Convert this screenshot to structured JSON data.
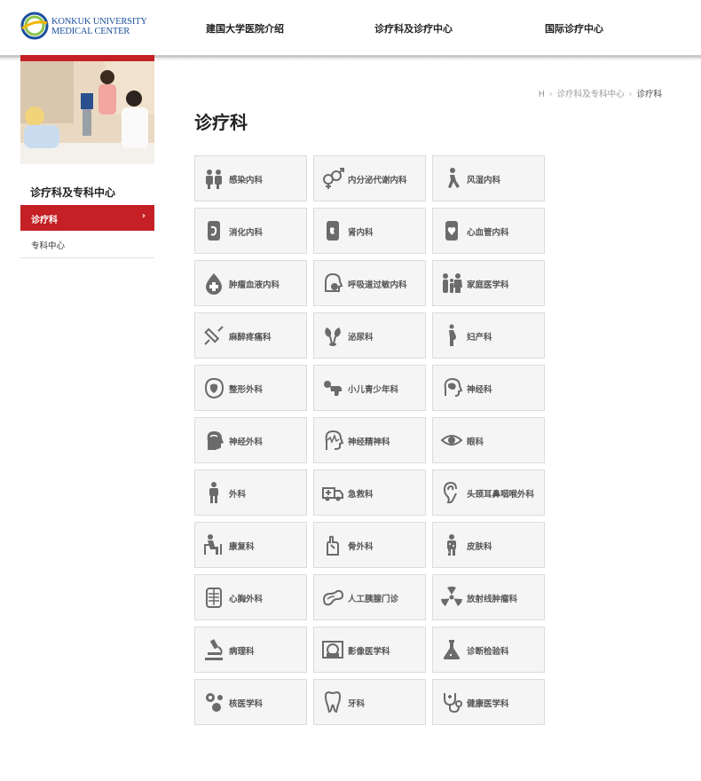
{
  "header": {
    "logo_line1": "KONKUK UNIVERSITY",
    "logo_line2": "MEDICAL CENTER",
    "nav": [
      "建国大学医院介绍",
      "诊疗科及诊疗中心",
      "国际诊疗中心"
    ]
  },
  "sidebar": {
    "title": "诊疗科及专科中心",
    "items": [
      {
        "label": "诊疗科",
        "active": true,
        "chevron": "›"
      },
      {
        "label": "专科中心",
        "active": false
      }
    ]
  },
  "breadcrumb": {
    "home": "H",
    "sep": "›",
    "items": [
      "诊疗科及专科中心",
      "诊疗科"
    ]
  },
  "main": {
    "title": "诊疗科",
    "departments": [
      {
        "label": "感染内科",
        "icon": "people-icon"
      },
      {
        "label": "内分泌代谢内科",
        "icon": "gender-icon"
      },
      {
        "label": "风湿内科",
        "icon": "walking-person-icon"
      },
      {
        "label": "消化内科",
        "icon": "stomach-icon"
      },
      {
        "label": "肾内科",
        "icon": "kidney-icon"
      },
      {
        "label": "心血管内科",
        "icon": "heart-icon"
      },
      {
        "label": "肿瘤血液内科",
        "icon": "blood-drop-icon"
      },
      {
        "label": "呼吸道过敏内科",
        "icon": "respiratory-icon"
      },
      {
        "label": "家庭医学科",
        "icon": "family-icon"
      },
      {
        "label": "麻醉疼痛科",
        "icon": "syringe-icon"
      },
      {
        "label": "泌尿科",
        "icon": "urinary-icon"
      },
      {
        "label": "妇产科",
        "icon": "pregnant-icon"
      },
      {
        "label": "整形外科",
        "icon": "face-icon"
      },
      {
        "label": "小儿青少年科",
        "icon": "baby-icon"
      },
      {
        "label": "神经科",
        "icon": "brain-profile-icon"
      },
      {
        "label": "神经外科",
        "icon": "head-icon"
      },
      {
        "label": "神经精神科",
        "icon": "mind-icon"
      },
      {
        "label": "眼科",
        "icon": "eye-icon"
      },
      {
        "label": "外科",
        "icon": "surgeon-icon"
      },
      {
        "label": "急救科",
        "icon": "ambulance-icon"
      },
      {
        "label": "头颈耳鼻咽喉外科",
        "icon": "ear-icon"
      },
      {
        "label": "康复科",
        "icon": "rehab-icon"
      },
      {
        "label": "骨外科",
        "icon": "bone-hand-icon"
      },
      {
        "label": "皮肤科",
        "icon": "skin-icon"
      },
      {
        "label": "心胸外科",
        "icon": "chest-icon"
      },
      {
        "label": "人工胰腺门诊",
        "icon": "pancreas-icon"
      },
      {
        "label": "放射线肿瘤科",
        "icon": "radiation-icon"
      },
      {
        "label": "病理科",
        "icon": "microscope-icon"
      },
      {
        "label": "影像医学科",
        "icon": "scanner-icon"
      },
      {
        "label": "诊断检验科",
        "icon": "flask-icon"
      },
      {
        "label": "核医学科",
        "icon": "nuclear-icon"
      },
      {
        "label": "牙科",
        "icon": "tooth-icon"
      },
      {
        "label": "健康医学科",
        "icon": "stethoscope-icon"
      }
    ]
  },
  "colors": {
    "accent": "#c42026",
    "logo": "#1a4f9c",
    "tile_bg": "#f5f5f5",
    "tile_border": "#dcdcdc"
  }
}
